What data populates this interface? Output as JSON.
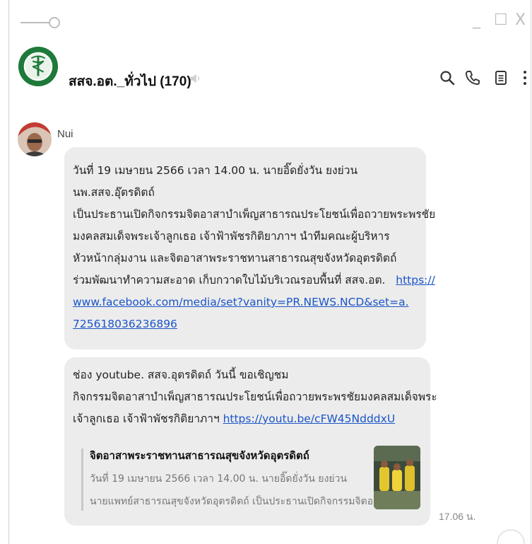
{
  "window": {
    "minimize_label": "_",
    "maximize_label": "☐",
    "close_label": "X"
  },
  "header": {
    "title": "สสจ.อต._ทั่วไป (170)"
  },
  "message": {
    "sender": "Nui",
    "bubble1_lines": [
      "วันที่ 19 เมษายน 2566 เวลา 14.00 น. นายอิ๊ดยั่งวัน ยงย่วน",
      "นพ.สสจ.อุ๊ตรดิตถ์",
      "เป็นประธานเปิดกิจกรรมจิตอาสาบำเพ็ญสาธารณประโยชน์เพื่อถวายพระพรชัย",
      "มงคลสมเด็จพระเจ้าลูกเธอ เจ้าฟ้าพัชรกิติยาภาฯ  นำทีมคณะผู้บริหาร",
      "หัวหน้ากลุ่มงาน และจิตอาสาพระราชทานสาธารณสุขจังหวัดอุตรดิตถ์",
      "ร่วมพัฒนาทำความสะอาด เก็บกวาดใบไม้บริเวณรอบพื้นที่ สสจ.อต."
    ],
    "bubble1_link_part1": "https://",
    "bubble1_link_part2": "www.facebook.com/media/set?vanity=PR.NEWS.NCD&set=a.",
    "bubble1_link_part3": "725618036236896",
    "bubble2_lines": [
      "ช่อง youtube. สสจ.อุตรดิตถ์ วันนี้ ขอเชิญชม",
      "กิจกรรมจิตอาสาบำเพ็ญสาธารณประโยชน์เพื่อถวายพระพรชัยมงคลสมเด็จพระ"
    ],
    "bubble2_line3_text": "เจ้าลูกเธอ เจ้าฟ้าพัชรกิติยาภาฯ ",
    "bubble2_link": "https://youtu.be/cFW45NdddxU",
    "preview": {
      "title": "จิตอาสาพระราชทานสาธารณสุขจังหวัดอุตรดิตถ์",
      "desc1": "วันที่ 19 เมษายน 2566 เวลา 14.00 น. นายอิ๊ดยั่งวัน ยงย่วน",
      "desc2": "นายแพทย์สาธารณสุขจังหวัดอุตรดิตถ์ เป็นประธานเปิดกิจกรรมจิตอา..."
    },
    "time": "17.06 น."
  },
  "colors": {
    "bubble": "#ececec",
    "link": "#1a55c9",
    "logo_green": "#1e7a3a"
  },
  "icons": [
    "pin-icon",
    "search-icon",
    "phone-icon",
    "notes-icon",
    "more-vertical-icon",
    "speaker-muted-icon"
  ]
}
